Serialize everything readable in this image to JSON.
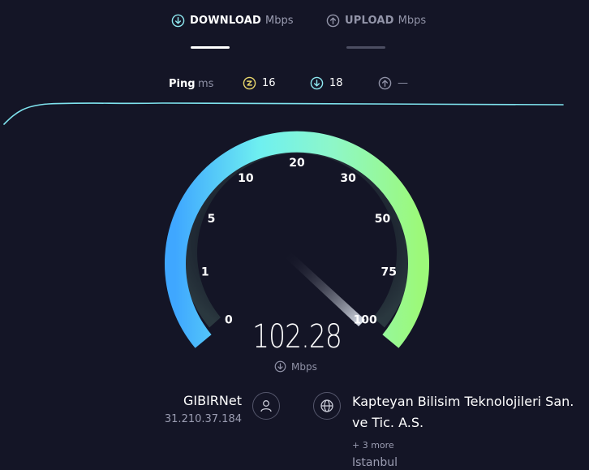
{
  "tabs": {
    "download": {
      "label": "DOWNLOAD",
      "unit": "Mbps",
      "icon": "arrow-down-circle-icon",
      "active": true
    },
    "upload": {
      "label": "UPLOAD",
      "unit": "Mbps",
      "icon": "arrow-up-circle-icon",
      "active": false
    }
  },
  "ping": {
    "label": "Ping",
    "unit": "ms",
    "jitter": {
      "icon": "bolt-circle-icon",
      "value": "16",
      "color": "#e8d66b"
    },
    "download": {
      "icon": "arrow-down-circle-icon",
      "value": "18",
      "color": "#8ee8f0"
    },
    "upload": {
      "icon": "arrow-up-circle-icon",
      "value": "—",
      "color": "#8f91a6"
    }
  },
  "gauge": {
    "ticks": [
      "0",
      "1",
      "5",
      "10",
      "20",
      "30",
      "50",
      "75",
      "100"
    ],
    "value": "102.28",
    "unit": "Mbps",
    "gradient": [
      "#3fa7ff",
      "#6ff0f0",
      "#8ef7c8",
      "#9cf97a"
    ]
  },
  "provider": {
    "name": "GIBIRNet",
    "ip": "31.210.37.184"
  },
  "server": {
    "name": "Kapteyan Bilisim Teknolojileri San. ve Tic. A.S.",
    "more": "+ 3 more",
    "city": "Istanbul"
  },
  "colors": {
    "background": "#141526",
    "wave": "#7fe3ee",
    "muted": "#8f91a6"
  }
}
